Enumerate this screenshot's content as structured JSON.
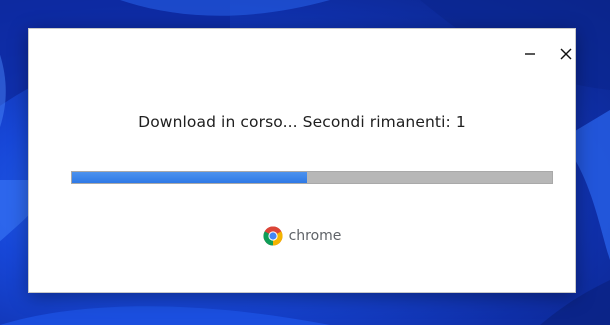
{
  "dialog": {
    "message": "Download in corso... Secondi rimanenti: 1",
    "progress_fraction": 0.49,
    "brand_label": "chrome",
    "minimize_icon": "minimize-icon",
    "close_icon": "close-icon",
    "brand_icon": "chrome-logo-icon"
  },
  "colors": {
    "progress_fill": "#3a84ea",
    "progress_track": "#b7b7b7",
    "dialog_bg": "#ffffff",
    "desktop_bg": "#1646d6"
  }
}
